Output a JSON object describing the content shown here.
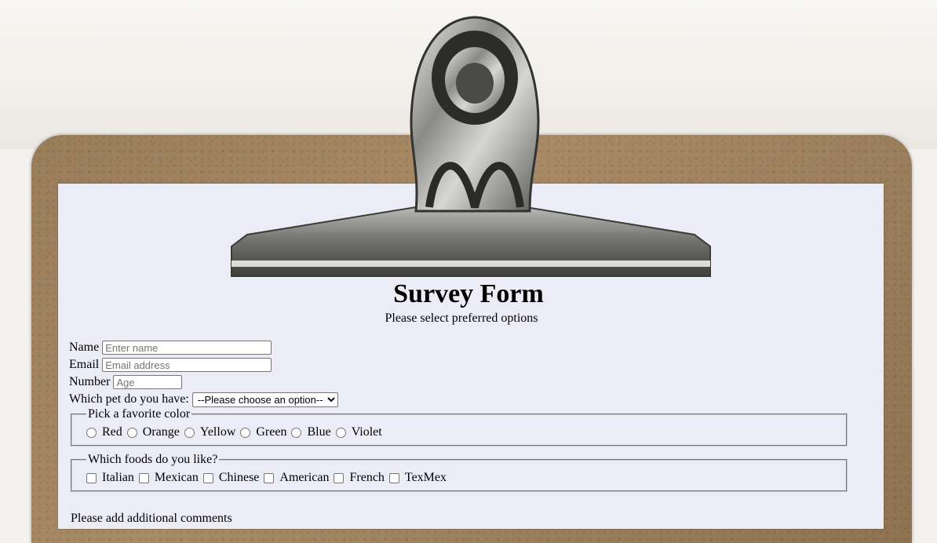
{
  "header": {
    "title": "Survey Form",
    "subtitle": "Please select preferred options"
  },
  "form": {
    "name_label": "Name",
    "name_placeholder": "Enter name",
    "email_label": "Email",
    "email_placeholder": "Email address",
    "number_label": "Number",
    "number_placeholder": "Age",
    "pet_label": "Which pet do you have:",
    "pet_selected": "--Please choose an option--",
    "color_legend": "Pick a favorite color",
    "colors": [
      "Red",
      "Orange",
      "Yellow",
      "Green",
      "Blue",
      "Violet"
    ],
    "foods_legend": "Which foods do you like?",
    "foods": [
      "Italian",
      "Mexican",
      "Chinese",
      "American",
      "French",
      "TexMex"
    ],
    "partial_next_label": "Please add additional comments"
  }
}
